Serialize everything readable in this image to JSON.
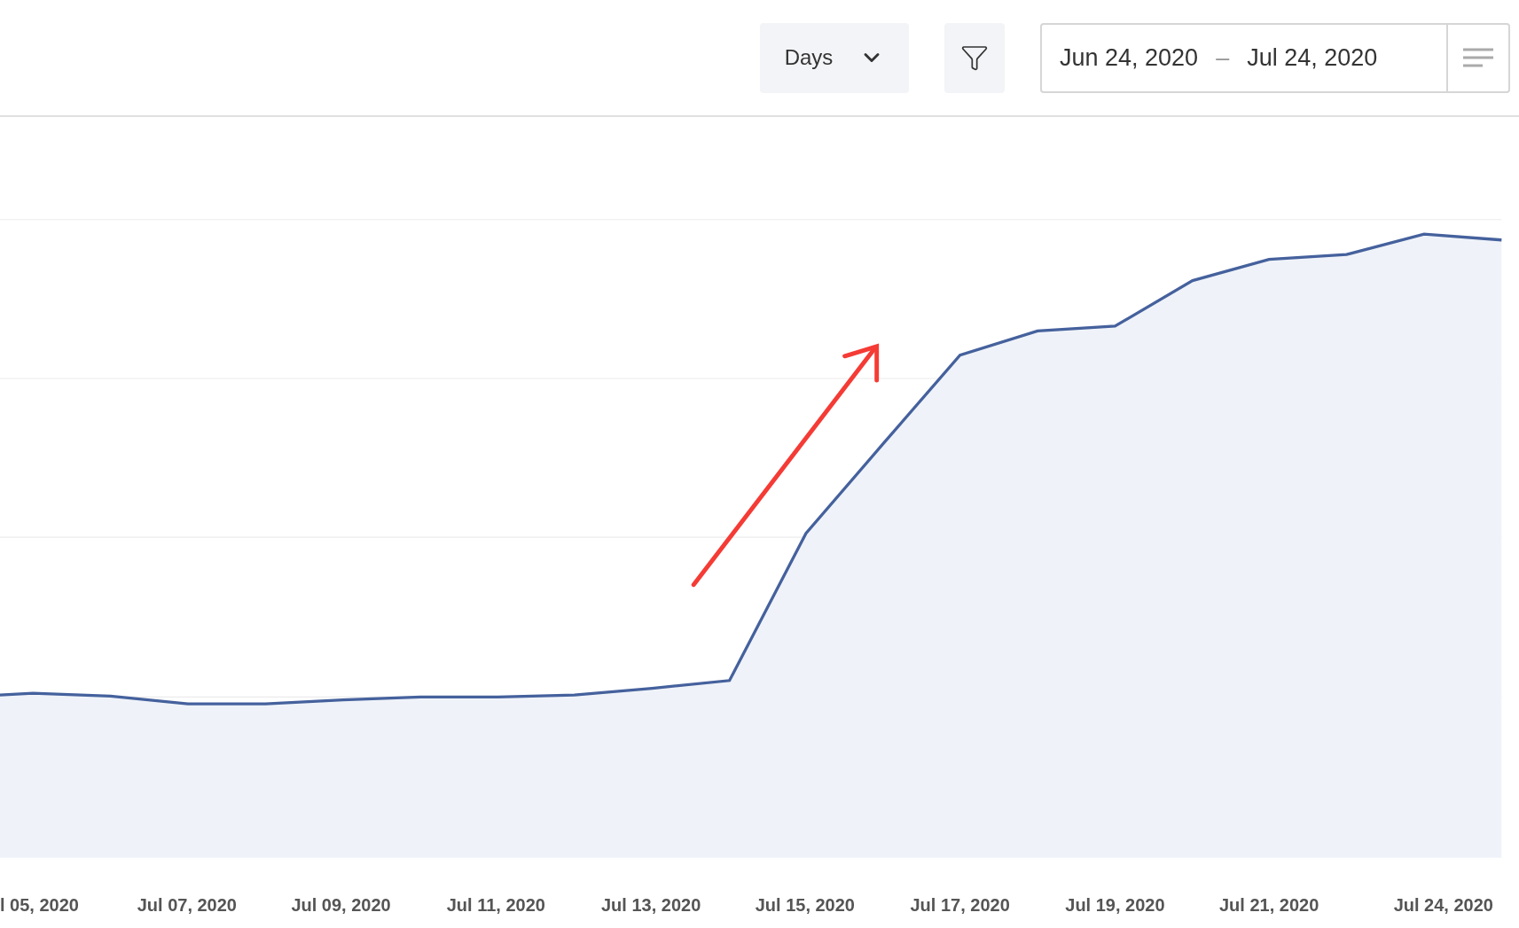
{
  "toolbar": {
    "interval": {
      "label": "Days"
    },
    "date_range": {
      "start": "Jun 24, 2020",
      "separator": "–",
      "end": "Jul 24, 2020"
    }
  },
  "chart": {
    "x_labels": [
      "l 05, 2020",
      "Jul 07, 2020",
      "Jul 09, 2020",
      "Jul 11, 2020",
      "Jul 13, 2020",
      "Jul 15, 2020",
      "Jul 17, 2020",
      "Jul 19, 2020",
      "Jul 21, 2020",
      "Jul 24, 2020"
    ]
  }
}
